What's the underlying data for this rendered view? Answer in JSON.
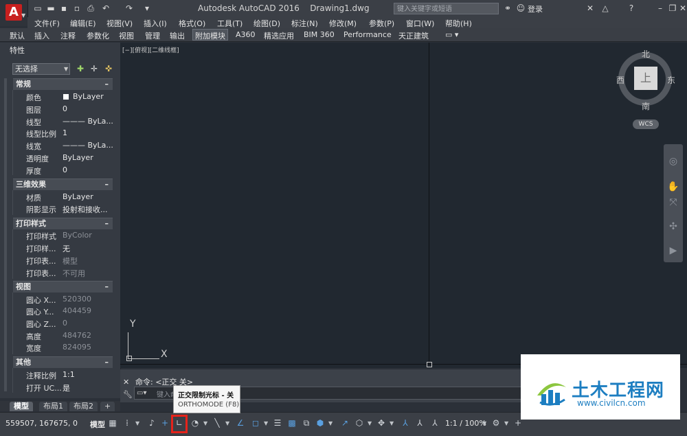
{
  "title_bar": {
    "app_name": "Autodesk AutoCAD 2016",
    "file_name": "Drawing1.dwg",
    "search_placeholder": "键入关键字或短语",
    "login": "登录"
  },
  "menu": [
    "文件(F)",
    "编辑(E)",
    "视图(V)",
    "插入(I)",
    "格式(O)",
    "工具(T)",
    "绘图(D)",
    "标注(N)",
    "修改(M)",
    "参数(P)",
    "窗口(W)",
    "帮助(H)"
  ],
  "ribbon_tabs": [
    "默认",
    "插入",
    "注释",
    "参数化",
    "视图",
    "管理",
    "输出",
    "附加模块",
    "A360",
    "精选应用",
    "BIM 360",
    "Performance",
    "天正建筑"
  ],
  "ribbon_active_tab": "附加模块",
  "properties": {
    "title": "特性",
    "selection": "无选择",
    "sections": [
      {
        "name": "常规",
        "rows": [
          {
            "label": "颜色",
            "value": "ByLayer",
            "swatch": "#ffffff"
          },
          {
            "label": "图层",
            "value": "0"
          },
          {
            "label": "线型",
            "value": "——— ByLa..."
          },
          {
            "label": "线型比例",
            "value": "1"
          },
          {
            "label": "线宽",
            "value": "——— ByLa..."
          },
          {
            "label": "透明度",
            "value": "ByLayer"
          },
          {
            "label": "厚度",
            "value": "0"
          }
        ]
      },
      {
        "name": "三维效果",
        "rows": [
          {
            "label": "材质",
            "value": "ByLayer"
          },
          {
            "label": "阴影显示",
            "value": "投射和接收..."
          }
        ]
      },
      {
        "name": "打印样式",
        "rows": [
          {
            "label": "打印样式",
            "value": "ByColor",
            "dim": true
          },
          {
            "label": "打印样...",
            "value": "无"
          },
          {
            "label": "打印表...",
            "value": "模型",
            "dim": true
          },
          {
            "label": "打印表...",
            "value": "不可用",
            "dim": true
          }
        ]
      },
      {
        "name": "视图",
        "rows": [
          {
            "label": "圆心 X...",
            "value": "520300",
            "dim": true
          },
          {
            "label": "圆心 Y...",
            "value": "404459",
            "dim": true
          },
          {
            "label": "圆心 Z...",
            "value": "0",
            "dim": true
          },
          {
            "label": "高度",
            "value": "484762",
            "dim": true
          },
          {
            "label": "宽度",
            "value": "824095",
            "dim": true
          }
        ]
      },
      {
        "name": "其他",
        "rows": [
          {
            "label": "注释比例",
            "value": "1:1"
          },
          {
            "label": "打开 UC...",
            "value": "是"
          }
        ]
      }
    ]
  },
  "viewport_label": "[−][俯视][二维线框]",
  "ucs": {
    "y": "Y",
    "x": "X"
  },
  "viewcube": {
    "north": "北",
    "south": "南",
    "east": "东",
    "west": "西",
    "face": "上",
    "wcs": "WCS"
  },
  "command": {
    "history": "命令:  <正交 关>",
    "placeholder": "键入命令"
  },
  "tooltip": {
    "title": "正交限制光标 - 关",
    "subtitle": "ORTHOMODE (F8)"
  },
  "layout_tabs": [
    "模型",
    "布局1",
    "布局2",
    "+"
  ],
  "status": {
    "coords": "559507, 167675, 0",
    "space": "模型",
    "scale": "1:1 / 100%"
  },
  "watermark": {
    "title": "土木工程网",
    "url": "www.civilcn.com"
  },
  "colors": {
    "highlight": "#e5231b",
    "canvas": "#212830",
    "brand": "#c8201f",
    "watermark": "#1d7ec1"
  }
}
